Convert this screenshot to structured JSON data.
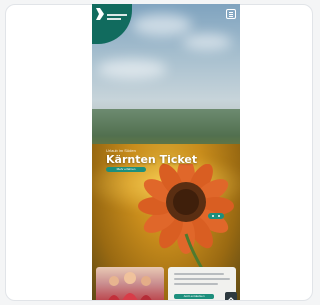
{
  "hero": {
    "eyebrow": "Urlaub im Süden",
    "title": "Kärnten Ticket",
    "cta_label": "Mehr erfahren"
  },
  "promo": {
    "cta_label": "Jetzt entdecken"
  },
  "colors": {
    "brand_green": "#116b5e",
    "accent_teal": "#1d8f7c",
    "sunflower_orange": "#e0672a",
    "flower_center": "#5a2e12"
  },
  "icons": {
    "logo": "brand-logo-icon",
    "menu": "menu-icon",
    "slider": "slider-arrows-icon",
    "scroll_top": "scroll-top-icon"
  }
}
